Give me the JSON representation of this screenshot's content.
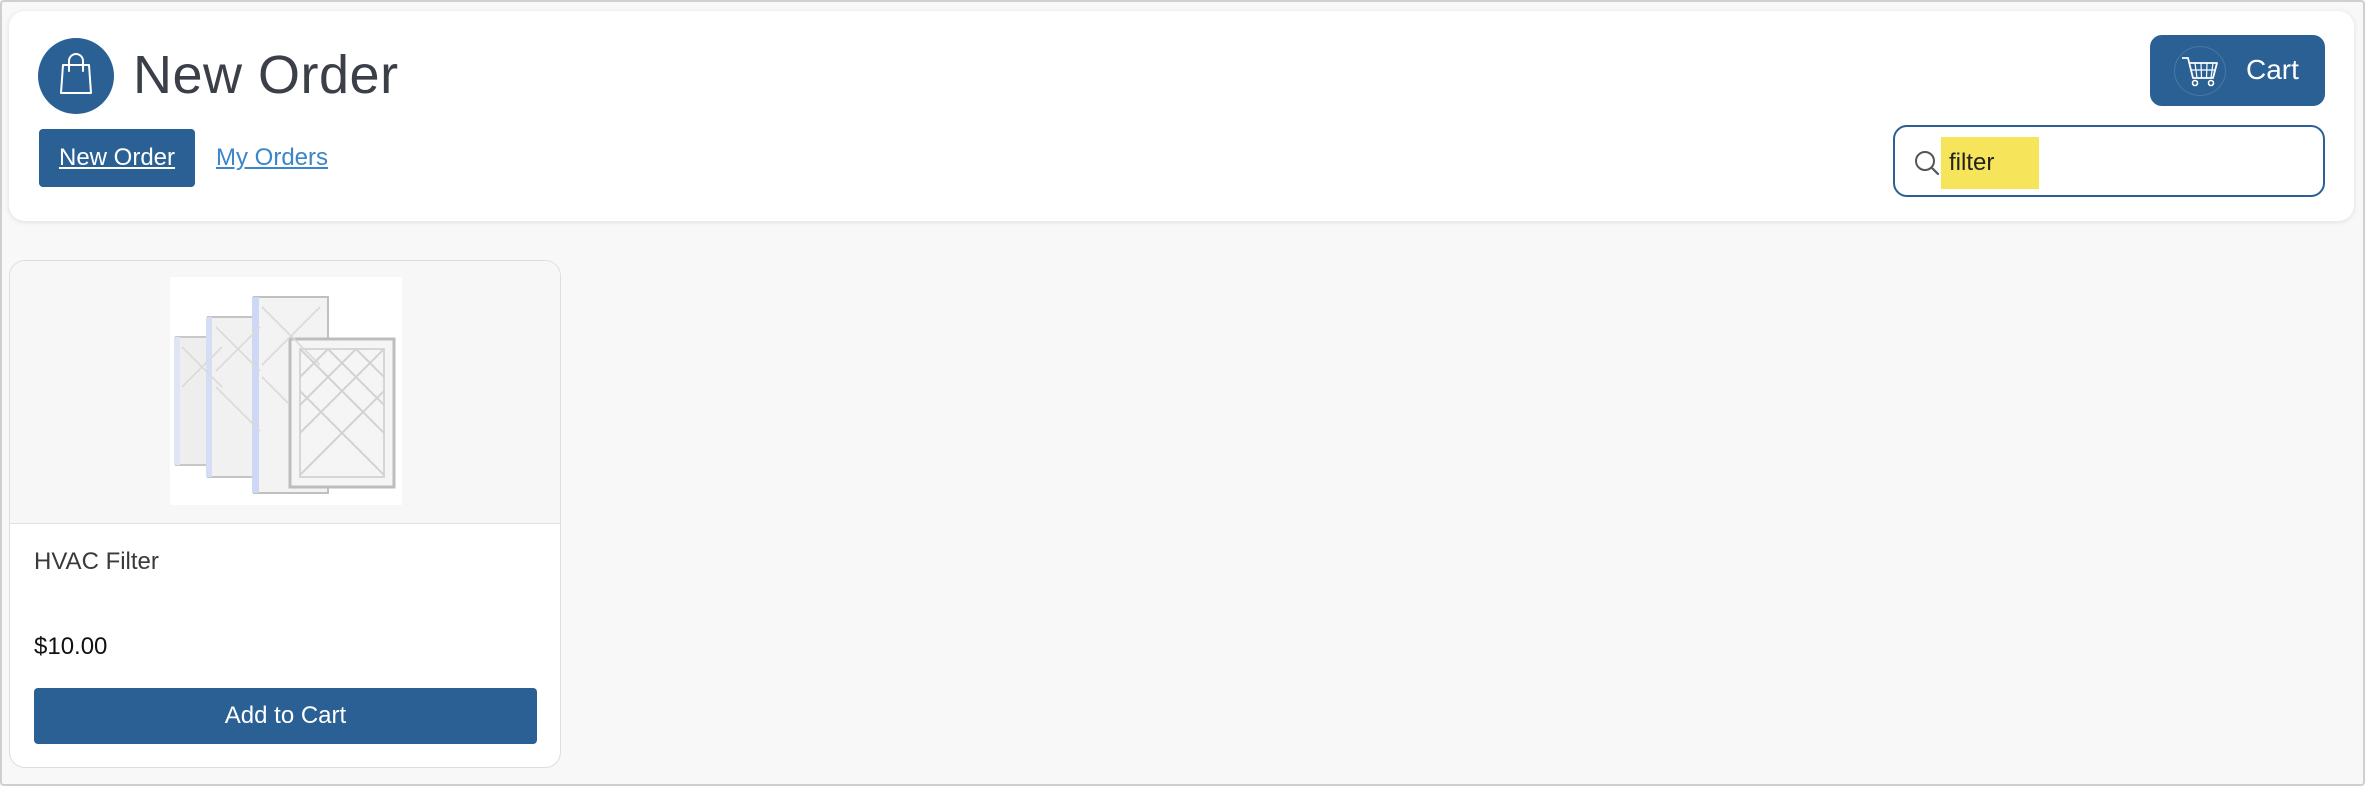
{
  "header": {
    "title": "New Order",
    "app_icon": "shopping-bag-icon",
    "tabs": [
      {
        "label": "New Order",
        "active": true
      },
      {
        "label": "My Orders",
        "active": false
      }
    ],
    "cart": {
      "label": "Cart",
      "icon": "cart-icon"
    },
    "search": {
      "value": "filter",
      "icon": "search-icon"
    }
  },
  "products": [
    {
      "name": "HVAC Filter",
      "price": "$10.00",
      "button_label": "Add to Cart",
      "image": "hvac-filter-image"
    }
  ],
  "colors": {
    "primary": "#2a6093",
    "link": "#3a86c8",
    "highlight": "#f6e55b",
    "background": "#f8f8f8"
  }
}
